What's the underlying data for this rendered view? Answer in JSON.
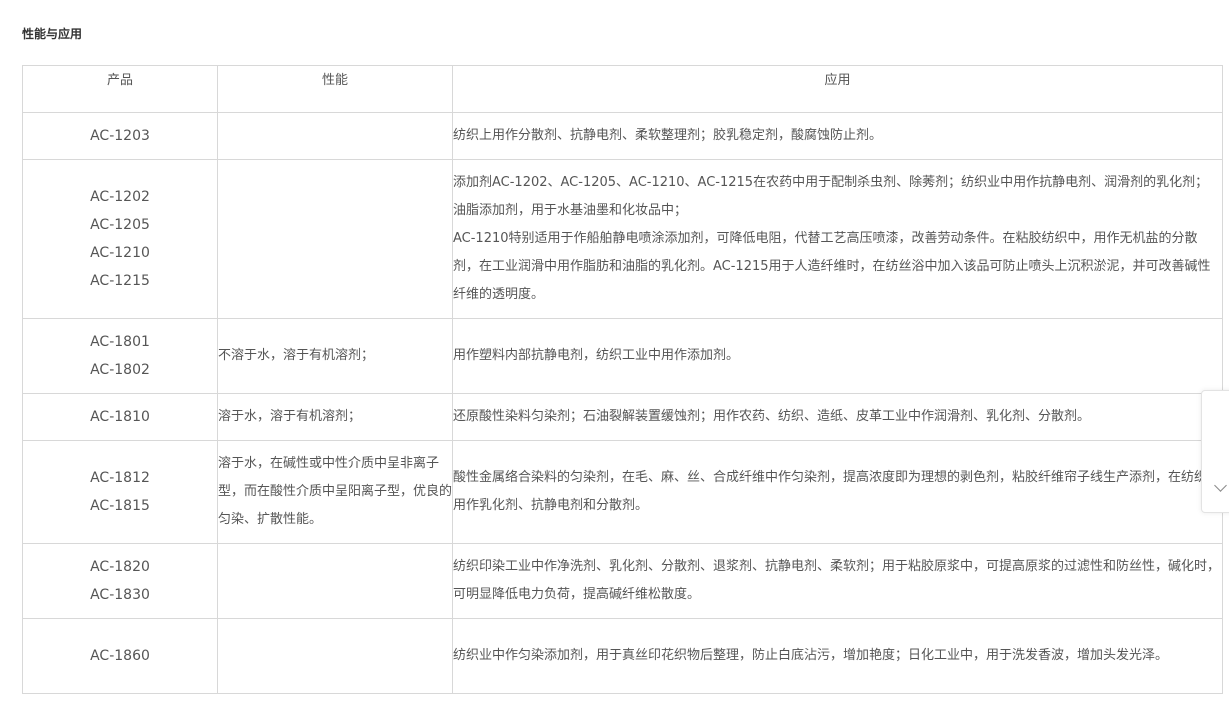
{
  "section_title": "性能与应用",
  "table": {
    "headers": [
      "产品",
      "性能",
      "应用"
    ],
    "rows": [
      {
        "products": [
          "AC-1203"
        ],
        "performance": "",
        "application": [
          "纺织上用作分散剂、抗静电剂、柔软整理剂；胶乳稳定剂，酸腐蚀防止剂。"
        ]
      },
      {
        "products": [
          "AC-1202",
          "AC-1205",
          "AC-1210",
          "AC-1215"
        ],
        "performance": "",
        "application": [
          "添加剂AC-1202、AC-1205、AC-1210、AC-1215在农药中用于配制杀虫剂、除莠剂；纺织业中用作抗静电剂、润滑剂的乳化剂；油脂添加剂，用于水基油墨和化妆品中；",
          "AC-1210特别适用于作船舶静电喷涂添加剂，可降低电阻，代替工艺高压喷漆，改善劳动条件。在粘胶纺织中，用作无机盐的分散剂，在工业润滑中用作脂肪和油脂的乳化剂。AC-1215用于人造纤维时，在纺丝浴中加入该品可防止喷头上沉积淤泥，并可改善碱性纤维的透明度。"
        ]
      },
      {
        "products": [
          "AC-1801",
          "AC-1802"
        ],
        "performance": "不溶于水，溶于有机溶剂；",
        "application": [
          "用作塑料内部抗静电剂，纺织工业中用作添加剂。"
        ]
      },
      {
        "products": [
          "AC-1810"
        ],
        "performance": "溶于水，溶于有机溶剂；",
        "application": [
          "还原酸性染料匀染剂；石油裂解装置缓蚀剂；用作农药、纺织、造纸、皮革工业中作润滑剂、乳化剂、分散剂。"
        ]
      },
      {
        "products": [
          "AC-1812",
          "AC-1815"
        ],
        "performance": "溶于水，在碱性或中性介质中呈非离子型，而在酸性介质中呈阳离子型，优良的匀染、扩散性能。",
        "application": [
          "酸性金属络合染料的匀染剂，在毛、麻、丝、合成纤维中作匀染剂，提高浓度即为理想的剥色剂，粘胶纤维帘子线生产添剂，在纺织品中用作乳化剂、抗静电剂和分散剂。"
        ]
      },
      {
        "products": [
          "AC-1820",
          "AC-1830"
        ],
        "performance": "",
        "application": [
          "纺织印染工业中作净洗剂、乳化剂、分散剂、退浆剂、抗静电剂、柔软剂；用于粘胶原浆中，可提高原浆的过滤性和防丝性，碱化时，可明显降低电力负荷，提高碱纤维松散度。"
        ]
      },
      {
        "products": [
          "AC-1860"
        ],
        "performance": "",
        "application": [
          "纺织业中作匀染添加剂，用于真丝印花织物后整理，防止白底沾污，增加艳度；日化工业中，用于洗发香波，增加头发光泽。"
        ]
      }
    ]
  },
  "side_widget": {
    "icon": "chevron-down-icon"
  }
}
